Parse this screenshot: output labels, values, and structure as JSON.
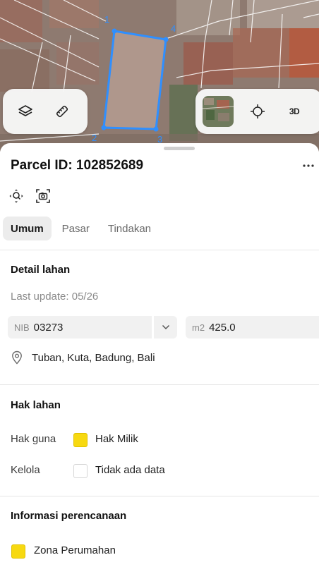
{
  "map": {
    "vertices": [
      "1",
      "4",
      "2",
      "3"
    ],
    "parcel_color": "#2f8fff",
    "controls": {
      "layers_icon": "layers-icon",
      "measure_icon": "ruler-icon",
      "locate_icon": "crosshair-icon",
      "view_3d_label": "3D"
    }
  },
  "parcel": {
    "title": "Parcel ID: 102852689",
    "actions": [
      "focus-icon",
      "screenshot-icon"
    ]
  },
  "tabs": [
    {
      "label": "Umum",
      "active": true
    },
    {
      "label": "Pasar",
      "active": false
    },
    {
      "label": "Tindakan",
      "active": false
    }
  ],
  "detail": {
    "section_title": "Detail lahan",
    "last_update": "Last update: 05/26",
    "nib_prefix": "NIB",
    "nib_value": "03273",
    "area_prefix": "m2",
    "area_value": "425.0",
    "location": "Tuban, Kuta, Badung, Bali"
  },
  "rights": {
    "section_title": "Hak lahan",
    "rows": [
      {
        "label": "Hak guna",
        "value": "Hak Milik",
        "swatch": "#f7d911"
      },
      {
        "label": "Kelola",
        "value": "Tidak ada data",
        "swatch": "#ffffff"
      }
    ]
  },
  "planning": {
    "section_title": "Informasi perencanaan",
    "zone": "Zona Perumahan",
    "zone_color": "#f7d911"
  }
}
